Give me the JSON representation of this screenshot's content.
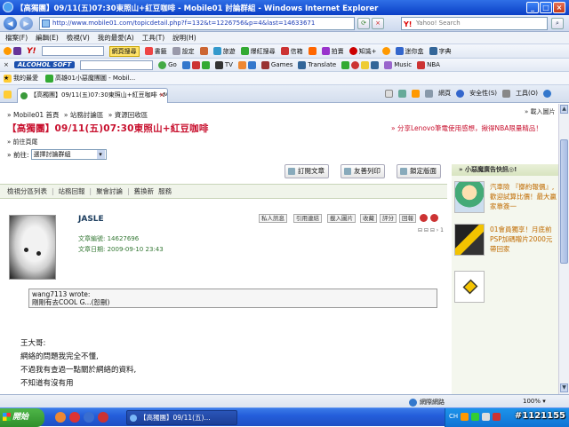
{
  "window": {
    "title": "【高獨團】09/11(五)07:30東照山+紅豆咖啡 - Mobile01 討論群組 - Windows Internet Explorer",
    "min": "_",
    "max": "□",
    "close": "×"
  },
  "address": {
    "url": "http://www.mobile01.com/topicdetail.php?f=132&t=1226756&p=4&last=14633671",
    "search_placeholder": "Yahoo! Search"
  },
  "menu": [
    "檔案(F)",
    "編輯(E)",
    "檢視(V)",
    "我的最愛(A)",
    "工具(T)",
    "說明(H)"
  ],
  "toolbar1": {
    "yahoo": "Y!",
    "items": [
      "網頁搜尋",
      "書籤",
      "設定",
      "",
      "旅遊",
      "爆紅搜尋",
      "信箱",
      "",
      "拍賣",
      "知識+",
      "",
      "迷你盒",
      "字典"
    ]
  },
  "toolbar2": {
    "brand": "ALCOHOL SOFT",
    "items": [
      "Go",
      "TV",
      "Games",
      "Translate",
      "Music",
      "NBA"
    ]
  },
  "favorites": {
    "fav_label": "我的最愛",
    "item": "高雄01小惡魔團圖 - Mobil..."
  },
  "tab": {
    "label": "【高獨團】09/11(五)07:30東照山+紅豆咖啡 - Mobi...",
    "right_items": [
      "",
      "",
      "",
      "",
      "網頁",
      "",
      "安全性(S)",
      "",
      "工具(O)",
      "",
      ""
    ]
  },
  "page": {
    "breadcrumb": [
      "» Mobile01 首頁",
      "» 站務討論區",
      "» 資源回收區"
    ],
    "print_link": "» 載入圖片",
    "title": "【高獨團】09/11(五)07:30東照山+紅豆咖啡",
    "promo": "» 分享Lenovo筆電使用感想，揪得NBA限量精品！",
    "prevnext": "» 前往頁尾",
    "goto_label": "» 前往:",
    "goto_select": "選擇討論群組",
    "actions": [
      "訂閱文章",
      "友善列印",
      "鎖定版面"
    ],
    "forum_nav": [
      "檢視分區列表",
      "站務回報",
      "聚會討論",
      "舊換新",
      "服務"
    ],
    "post": {
      "username": "JASLE",
      "meta_id": "文章編號: 14627696",
      "meta_date": "文章日期: 2009-09-10 23:43",
      "buttons": [
        "私人訊息",
        "引用連結",
        "載入圖片",
        "收藏",
        "評分",
        "回報"
      ],
      "page_btns": "⊟ ⊟ ⊟ › 1",
      "quote_author": "wang7113 wrote:",
      "quote_text": "剛剛有去COOL G...(恕刪)",
      "body": [
        "王大哥:",
        "網絡的問題我完全不懂,",
        "不過我有查過一點關於網絡的資料,",
        "不知道有沒有用"
      ]
    }
  },
  "ads": {
    "header": "» 小惡魔廣告快訊◎!",
    "items": [
      {
        "text": "汽車險 『擲約報價』, 歡迎試算比價！最大贏家靠簽一"
      },
      {
        "text": "01會員獨享！月底前PSP加碼贈片2000元帶回家"
      },
      {
        "text": ""
      }
    ]
  },
  "status": {
    "zone": "網際網路",
    "zoom": "100%"
  },
  "taskbar": {
    "start": "開始",
    "item": "【高獨團】09/11(五)...",
    "tray": [
      "CH",
      "",
      "",
      "",
      "",
      ""
    ],
    "watermark": "#1121155"
  }
}
